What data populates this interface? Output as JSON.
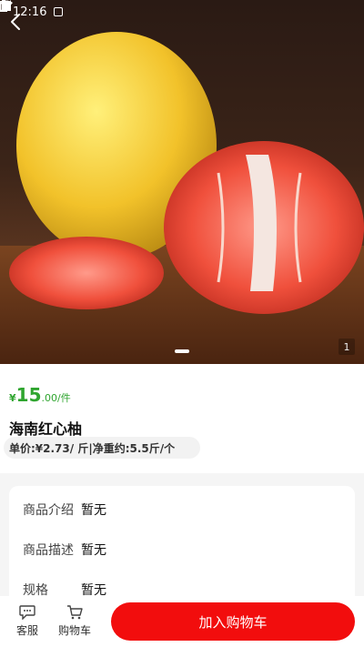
{
  "status_bar": {
    "time": "12:16"
  },
  "hero": {
    "page_index": "1"
  },
  "product": {
    "currency_symbol": "¥",
    "price_main": "15",
    "price_suffix": ".00/件",
    "name": "海南红心柚",
    "unit_info": "单价:¥2.73/ 斤|净重约:5.5斤/个"
  },
  "details": [
    {
      "label": "商品介绍",
      "value": "暂无"
    },
    {
      "label": "商品描述",
      "value": "暂无"
    },
    {
      "label": "规格",
      "value": "暂无"
    }
  ],
  "bottom_bar": {
    "service_label": "客服",
    "cart_label": "购物车",
    "add_to_cart_label": "加入购物车"
  },
  "colors": {
    "price_green": "#2fa52f",
    "cta_red": "#f20d0d"
  },
  "icons": [
    "back-arrow-icon",
    "chat-icon",
    "cart-icon",
    "wifi-icon",
    "signal-icon",
    "battery-icon"
  ]
}
